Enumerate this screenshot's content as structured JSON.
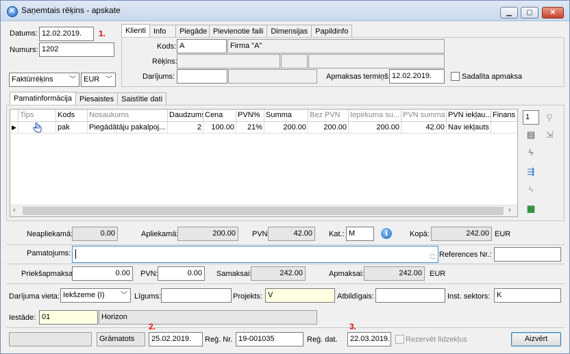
{
  "window": {
    "title": "Saņemtais rēķins - apskate",
    "minimize": "▁",
    "maximize": "▢",
    "close": "✕"
  },
  "header": {
    "datums_label": "Datums:",
    "datums_value": "12.02.2019.",
    "marker1": "1.",
    "numurs_label": "Numurs:",
    "numurs_value": "1202",
    "doc_type": "Faktūrrēķins",
    "currency": "EUR"
  },
  "top_tabs": [
    "Klienti",
    "Info",
    "Piegāde",
    "Pievienotie faili",
    "Dimensijas",
    "Papildinfo"
  ],
  "client": {
    "kods_label": "Kods:",
    "kods_value": "A",
    "name_value": "Firma \"A\"",
    "rekins_label": "Rēķins:",
    "darijums_label": "Darījums:",
    "apmaksas_label": "Apmaksas termiņš:",
    "apmaksas_value": "12.02.2019.",
    "sadalita_label": "Sadalīta apmaksa"
  },
  "main_tabs": [
    "Pamatinformācija",
    "Piesaistes",
    "Saistītie dati"
  ],
  "grid": {
    "columns": [
      "Tips",
      "Kods",
      "Nosaukums",
      "Daudzums",
      "Cena",
      "PVN%",
      "Summa",
      "Bez PVN",
      "Iepirkuma su...",
      "PVN summa",
      "PVN iekļau...",
      "Finans"
    ],
    "rows": [
      {
        "marker": "▶",
        "tips": "",
        "kods": "pak",
        "nosaukums": "Piegādātāju pakalpoj...",
        "daudzums": "2",
        "cena": "100.00",
        "pvn_pct": "21%",
        "summa": "200.00",
        "bez_pvn": "200.00",
        "iepirkuma": "200.00",
        "pvn_summa": "42.00",
        "pvn_ieklauts": "Nav iekļauts",
        "finans": ""
      }
    ],
    "page_num": "1"
  },
  "totals": {
    "neapliekama_label": "Neapliekamā:",
    "neapliekama_value": "0.00",
    "apliekama_label": "Apliekamā:",
    "apliekama_value": "200.00",
    "pvn_label": "PVN:",
    "pvn_value": "42.00",
    "kat_label": "Kat.:",
    "kat_value": "M",
    "kopa_label": "Kopā:",
    "kopa_value": "242.00",
    "kopa_currency": "EUR"
  },
  "pamatojums": {
    "label": "Pamatojums:",
    "value": "",
    "references_label": "References Nr.:",
    "references_value": ""
  },
  "payment": {
    "prieksapmaksa_label": "Priekšapmaksa:",
    "prieksapmaksa_value": "0.00",
    "pvn_label": "PVN:",
    "pvn_value": "0.00",
    "samaksai_label": "Samaksai:",
    "samaksai_value": "242.00",
    "apmaksai_label": "Apmaksai:",
    "apmaksai_value": "242.00",
    "currency": "EUR"
  },
  "details": {
    "darijuma_vieta_label": "Darījuma vieta:",
    "darijuma_vieta_value": "Iekšzeme (I)",
    "ligums_label": "Līgums:",
    "ligums_value": "",
    "projekts_label": "Projekts:",
    "projekts_value": "V",
    "atbildigais_label": "Atbildīgais:",
    "atbildigais_value": "",
    "inst_label": "Inst. sektors:",
    "inst_value": "K",
    "iestade_label": "Iestāde:",
    "iestade_code": "01",
    "iestade_name": "Horizon"
  },
  "footer": {
    "status_value": "Grāmatots",
    "date1": "25.02.2019.",
    "marker2": "2.",
    "reg_nr_label": "Reģ. Nr.",
    "reg_nr_value": "19-001035",
    "reg_dat_label": "Reģ. dat.",
    "reg_dat_value": "22.03.2019.",
    "marker3": "3.",
    "rezervet_label": "Rezervēt līdzekļus",
    "close_button": "Aizvērt"
  },
  "icons": {
    "app": "app-logo-icon",
    "hand": "hand-pointer-icon",
    "info": "info-icon"
  }
}
